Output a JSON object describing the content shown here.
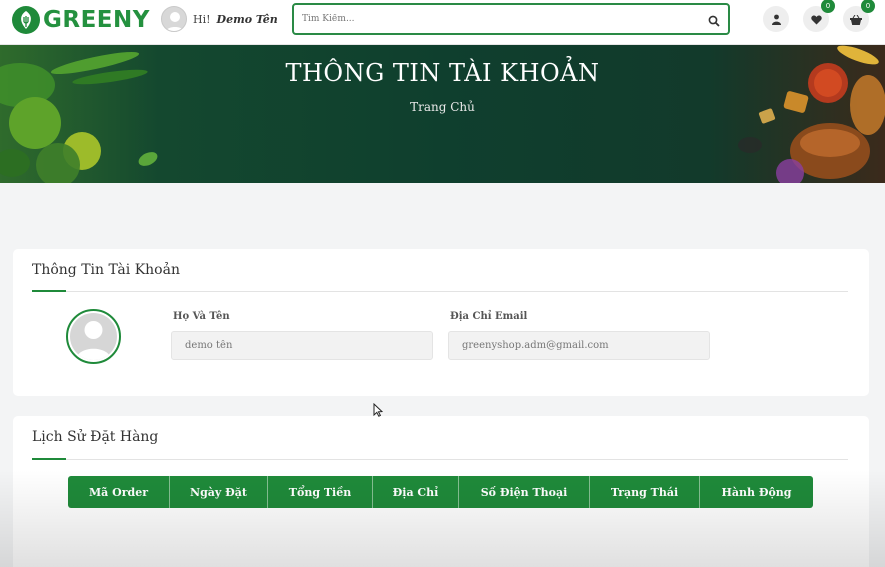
{
  "header": {
    "brand": "GREENY",
    "greeting_prefix": "Hi!",
    "user_name": "Demo Tên",
    "search_placeholder": "Tìm Kiếm...",
    "wishlist_count": "0",
    "cart_count": "0"
  },
  "banner": {
    "title": "THÔNG TIN TÀI KHOẢN",
    "breadcrumb": "Trang Chủ"
  },
  "account": {
    "title": "Thông Tin Tài Khoản",
    "name_label": "Họ Và Tên",
    "name_value": "demo tên",
    "email_label": "Địa Chỉ Email",
    "email_value": "greenyshop.adm@gmail.com"
  },
  "orders": {
    "title": "Lịch Sử Đặt Hàng",
    "columns": [
      "Mã Order",
      "Ngày Đặt",
      "Tổng Tiền",
      "Địa Chỉ",
      "Số Điện Thoại",
      "Trạng Thái",
      "Hành Động"
    ]
  },
  "colors": {
    "brand_green": "#1f8a3a",
    "banner_dark": "#0f3f2e"
  },
  "icons": [
    "leaf-logo-icon",
    "search-icon",
    "user-icon",
    "heart-icon",
    "basket-icon",
    "avatar-placeholder-icon"
  ]
}
